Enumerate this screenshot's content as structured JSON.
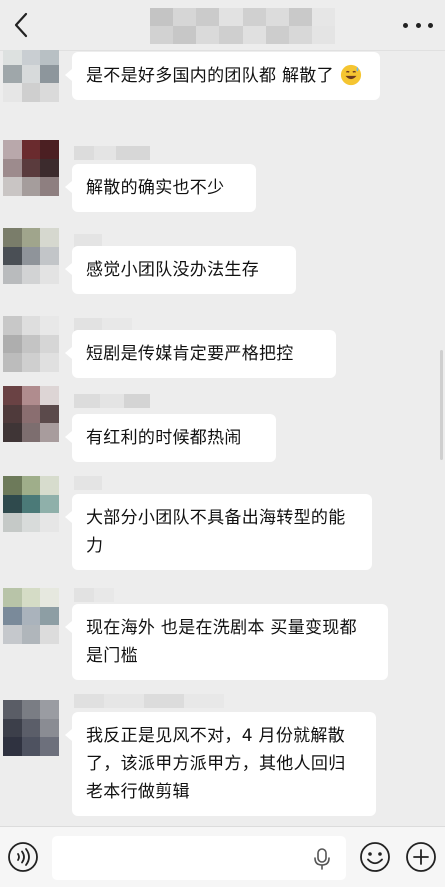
{
  "header": {
    "back_icon": "chevron-left-icon",
    "more_icon": "more-dots-icon"
  },
  "messages": [
    {
      "text": "是不是好多国内的团队都 解散了",
      "emoji": "grinning-sweat-emoji"
    },
    {
      "text": "解散的确实也不少"
    },
    {
      "text": "感觉小团队没办法生存"
    },
    {
      "text": "短剧是传媒肯定要严格把控"
    },
    {
      "text": "有红利的时候都热闹"
    },
    {
      "text": "大部分小团队不具备出海转型的能力"
    },
    {
      "text": "现在海外 也是在洗剧本  买量变现都是门槛"
    },
    {
      "text": "我反正是见风不对，4 月份就解散了，该派甲方派甲方，其他人回归老本行做剪辑"
    }
  ],
  "input_bar": {
    "value": "",
    "voice_icon": "voice-input-icon",
    "mic_icon": "microphone-icon",
    "emoji_icon": "emoji-face-icon",
    "plus_icon": "plus-icon"
  }
}
